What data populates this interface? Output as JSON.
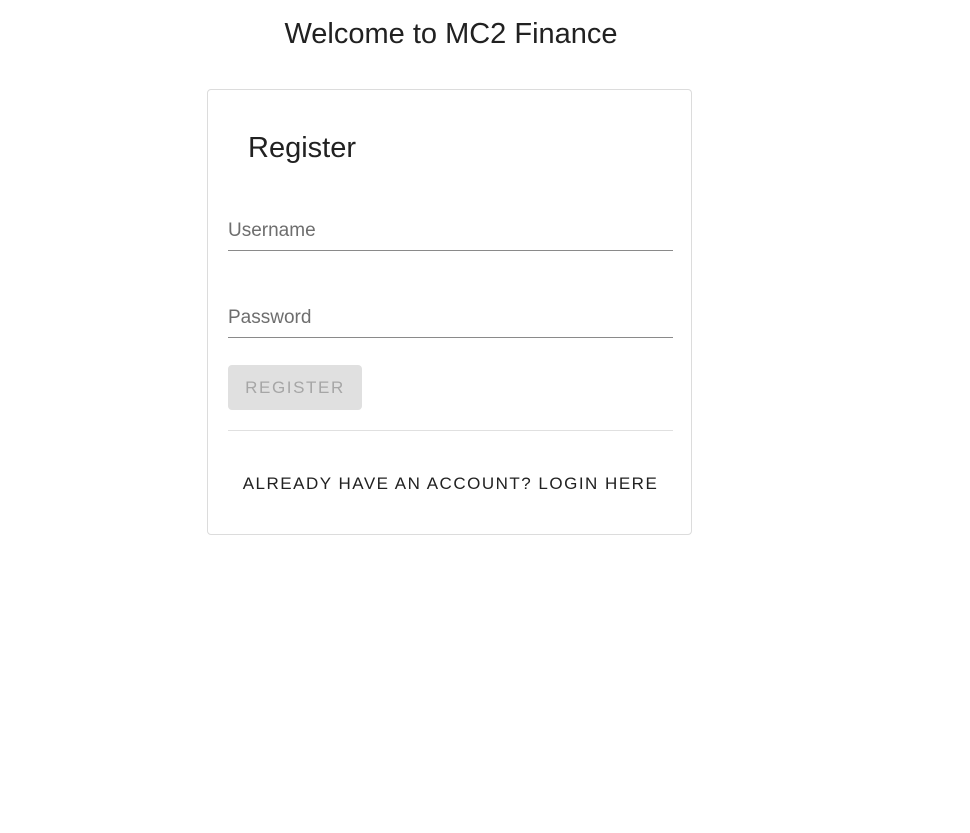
{
  "header": {
    "title": "Welcome to MC2 Finance"
  },
  "register_card": {
    "title": "Register",
    "username": {
      "value": "",
      "placeholder": "Username"
    },
    "password": {
      "value": "",
      "placeholder": "Password"
    },
    "register_button_label": "REGISTER",
    "register_button_disabled": true,
    "login_link_label": "ALREADY HAVE AN ACCOUNT? LOGIN HERE"
  },
  "colors": {
    "text": "#212121",
    "placeholder": "#6e6e6e",
    "disabled_button_bg": "#e0e0e0",
    "disabled_button_text": "#a6a6a6",
    "card_border": "#dcdcdc"
  }
}
